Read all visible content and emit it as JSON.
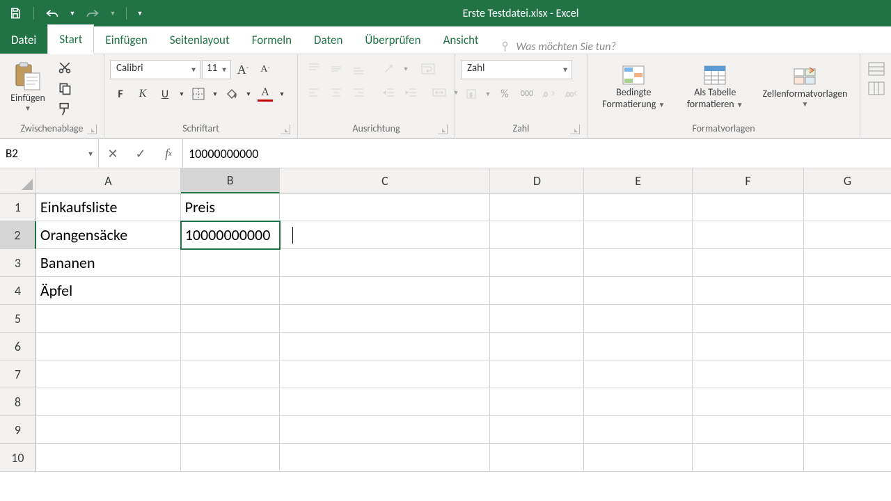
{
  "window_title": "Erste Testdatei.xlsx - Excel",
  "qat": {
    "save": "save",
    "undo": "undo",
    "redo": "redo"
  },
  "tabs": {
    "file": "Datei",
    "home": "Start",
    "insert": "Einfügen",
    "page_layout": "Seitenlayout",
    "formulas": "Formeln",
    "data": "Daten",
    "review": "Überprüfen",
    "view": "Ansicht",
    "tell_me": "Was möchten Sie tun?"
  },
  "ribbon": {
    "clipboard": {
      "title": "Zwischenablage",
      "paste": "Einfügen"
    },
    "font": {
      "title": "Schriftart",
      "name": "Calibri",
      "size": "11",
      "bold": "F",
      "italic": "K",
      "underline": "U"
    },
    "alignment": {
      "title": "Ausrichtung"
    },
    "number": {
      "title": "Zahl",
      "format": "Zahl",
      "percent": "%",
      "thousands": "000"
    },
    "styles": {
      "title": "Formatvorlagen",
      "cond_fmt_l1": "Bedingte",
      "cond_fmt_l2": "Formatierung",
      "as_table_l1": "Als Tabelle",
      "as_table_l2": "formatieren",
      "cell_styles": "Zellenformatvorlagen"
    }
  },
  "fx": {
    "namebox": "B2",
    "formula": "10000000000"
  },
  "columns": [
    "A",
    "B",
    "C",
    "D",
    "E",
    "F",
    "G"
  ],
  "rows": [
    "1",
    "2",
    "3",
    "4",
    "5",
    "6",
    "7",
    "8",
    "9",
    "10"
  ],
  "cells": {
    "A1": "Einkaufsliste",
    "B1": "Preis",
    "A2": "Orangensäcke",
    "B2": "10000000000",
    "A3": "Bananen",
    "A4": "Äpfel"
  },
  "active_cell": "B2"
}
